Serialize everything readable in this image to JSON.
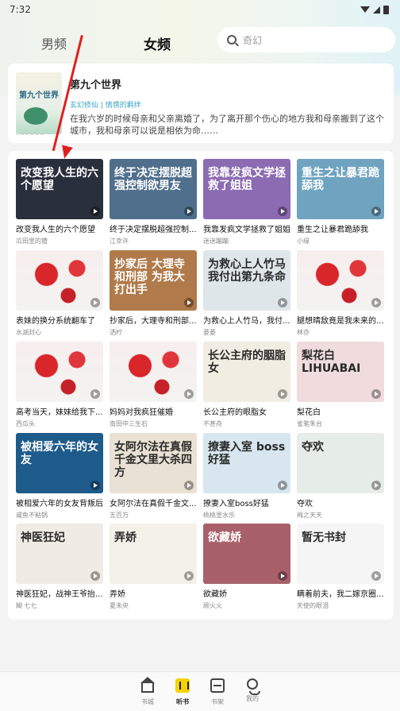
{
  "status": {
    "time": "7:32"
  },
  "tabs": [
    {
      "label": "男频",
      "active": false
    },
    {
      "label": "女频",
      "active": true
    }
  ],
  "search": {
    "placeholder": "奇幻",
    "icon": "search-icon"
  },
  "featured": {
    "cover_text": "第九个世界",
    "title": "第九个世界",
    "tags": "玄幻修仙 | 情感的羁绊",
    "description": "在我六岁的时候母亲和父亲离婚了，为了离开那个伤心的地方我和母亲搬到了这个城市，我和母亲可以说是相依为命……"
  },
  "books": [
    {
      "title": "改变我人生的六个愿望",
      "author": "瓜田里的猹",
      "cover_text": "改变我人生的六个愿望",
      "cover_color": "#2a2f3c"
    },
    {
      "title": "终于决定摆脱超强控制...",
      "author": "江幸许",
      "cover_text": "终于决定摆脱超强控制欲男友",
      "cover_color": "#4f6f8c"
    },
    {
      "title": "我靠发疯文学拯救了姐姐",
      "author": "迷迷蹦蹦",
      "cover_text": "我靠发疯文学拯救了姐姐",
      "cover_color": "#8b6bb2"
    },
    {
      "title": "重生之让暴君跪舔我",
      "author": "小缘",
      "cover_text": "重生之让暴君跪舔我",
      "cover_color": "#6fa3bf"
    },
    {
      "title": "表妹的换分系统翻车了",
      "author": "水湖封心",
      "cover_text": "",
      "cover_color": "poppy"
    },
    {
      "title": "抄家后，大理寺和刑部...",
      "author": "洒柠",
      "cover_text": "抄家后 大理寺和刑部 为我大打出手",
      "cover_color": "#b07a4a"
    },
    {
      "title": "为救心上人竹马，我付...",
      "author": "菱菱",
      "cover_text": "为救心上人竹马 我付出第九条命",
      "cover_color": "#dfe6ea"
    },
    {
      "title": "腿想晴敌竟是我未来的...",
      "author": "林亦",
      "cover_text": "",
      "cover_color": "poppy"
    },
    {
      "title": "高考当天，妹妹给我下...",
      "author": "西瓜头",
      "cover_text": "",
      "cover_color": "poppy"
    },
    {
      "title": "妈妈对我疯狂催婚",
      "author": "南田中三生石",
      "cover_text": "",
      "cover_color": "poppy"
    },
    {
      "title": "长公主府的眼脂女",
      "author": "不甚舟",
      "cover_text": "长公主府的胭脂女",
      "cover_color": "#f1ede3"
    },
    {
      "title": "梨花白",
      "author": "雀笔朱台",
      "cover_text": "梨花白 LIHUABAI",
      "cover_color": "#f0dcdc"
    },
    {
      "title": "被相爱六年的女友背叛后",
      "author": "咸鱼不粘锅",
      "cover_text": "被相爱六年的女友",
      "cover_color": "#1d5b8a"
    },
    {
      "title": "女阿尔法在真假千金文...",
      "author": "五百万",
      "cover_text": "女阿尔法在真假千金文里大杀四方",
      "cover_color": "#e9e1d3"
    },
    {
      "title": "撩妻入室boss好猛",
      "author": "桃桃里水乐",
      "cover_text": "撩妻入室 boss好猛",
      "cover_color": "#d7e6ef"
    },
    {
      "title": "夺欢",
      "author": "梅之天天",
      "cover_text": "夺欢",
      "cover_color": "#e6ece8"
    },
    {
      "title": "神医狂妃，战神王爷抬...",
      "author": "糊 七七",
      "cover_text": "神医狂妃",
      "cover_color": "#f0ebe4"
    },
    {
      "title": "弄娇",
      "author": "夏未央",
      "cover_text": "弄娇",
      "cover_color": "#f4f1ea"
    },
    {
      "title": "欲藏娇",
      "author": "顾火火",
      "cover_text": "欲藏娇",
      "cover_color": "#a8616a"
    },
    {
      "title": "瞒着前夫，我二嫁京圈...",
      "author": "天使的眼泪",
      "cover_text": "暂无书封",
      "cover_color": "#f5f5f5"
    }
  ],
  "bottom_nav": [
    {
      "label": "书城",
      "icon": "home-icon",
      "active": false
    },
    {
      "label": "听书",
      "icon": "listen-icon",
      "active": true
    },
    {
      "label": "书架",
      "icon": "shelf-icon",
      "active": false
    },
    {
      "label": "我的",
      "icon": "me-icon",
      "active": false
    }
  ]
}
